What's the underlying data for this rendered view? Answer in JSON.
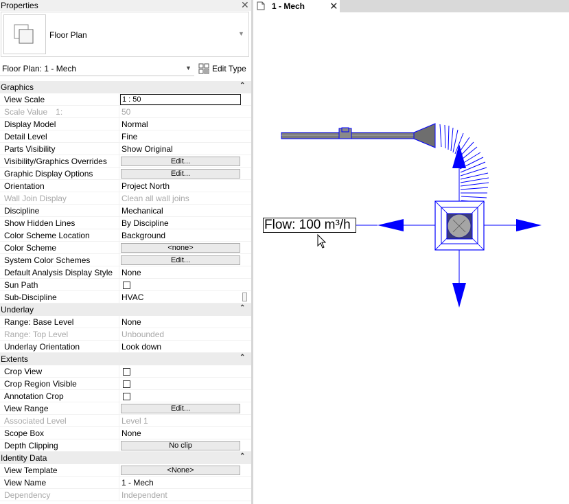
{
  "properties_panel": {
    "title": "Properties",
    "close_glyph": "✕",
    "type_selector": {
      "name": "Floor Plan",
      "thumb_icon": "floor-plan-icon"
    },
    "view_selector": {
      "value": "Floor Plan: 1 - Mech"
    },
    "edit_type_label": "Edit Type"
  },
  "groups": {
    "graphics": "Graphics",
    "underlay": "Underlay",
    "extents": "Extents",
    "identity": "Identity Data"
  },
  "graphics": {
    "view_scale": {
      "name": "View Scale",
      "value": "1 : 50"
    },
    "scale_value": {
      "name": "Scale Value",
      "mid": "1:",
      "value": "50"
    },
    "display_model": {
      "name": "Display Model",
      "value": "Normal"
    },
    "detail_level": {
      "name": "Detail Level",
      "value": "Fine"
    },
    "parts_visibility": {
      "name": "Parts Visibility",
      "value": "Show Original"
    },
    "vg_overrides": {
      "name": "Visibility/Graphics Overrides",
      "value": "Edit..."
    },
    "graphic_display": {
      "name": "Graphic Display Options",
      "value": "Edit..."
    },
    "orientation": {
      "name": "Orientation",
      "value": "Project North"
    },
    "wall_join": {
      "name": "Wall Join Display",
      "value": "Clean all wall joins"
    },
    "discipline": {
      "name": "Discipline",
      "value": "Mechanical"
    },
    "hidden_lines": {
      "name": "Show Hidden Lines",
      "value": "By Discipline"
    },
    "color_scheme_location": {
      "name": "Color Scheme Location",
      "value": "Background"
    },
    "color_scheme": {
      "name": "Color Scheme",
      "value": "<none>"
    },
    "system_color_schemes": {
      "name": "System Color Schemes",
      "value": "Edit..."
    },
    "default_analysis": {
      "name": "Default Analysis Display Style",
      "value": "None"
    },
    "sun_path": {
      "name": "Sun Path",
      "checked": false
    },
    "sub_discipline": {
      "name": "Sub-Discipline",
      "value": "HVAC"
    }
  },
  "underlay": {
    "base_level": {
      "name": "Range: Base Level",
      "value": "None"
    },
    "top_level": {
      "name": "Range: Top Level",
      "value": "Unbounded"
    },
    "orientation": {
      "name": "Underlay Orientation",
      "value": "Look down"
    }
  },
  "extents": {
    "crop_view": {
      "name": "Crop View",
      "checked": false
    },
    "crop_region_visible": {
      "name": "Crop Region Visible",
      "checked": false
    },
    "annotation_crop": {
      "name": "Annotation Crop",
      "checked": false
    },
    "view_range": {
      "name": "View Range",
      "value": "Edit..."
    },
    "associated_level": {
      "name": "Associated Level",
      "value": "Level 1"
    },
    "scope_box": {
      "name": "Scope Box",
      "value": "None"
    },
    "depth_clipping": {
      "name": "Depth Clipping",
      "value": "No clip"
    }
  },
  "identity": {
    "view_template": {
      "name": "View Template",
      "value": "<None>"
    },
    "view_name": {
      "name": "View Name",
      "value": "1 - Mech"
    },
    "dependency": {
      "name": "Dependency",
      "value": "Independent"
    }
  },
  "view_tab": {
    "label": "1 - Mech",
    "close_glyph": "✕",
    "icon": "floor-plan-view-icon"
  },
  "canvas": {
    "flow_tag": "Flow: 100 m³/h",
    "colors": {
      "selection": "#0000ff",
      "duct_fill": "#7a7a7a",
      "diffuser_fill": "#b8b8b8"
    }
  }
}
